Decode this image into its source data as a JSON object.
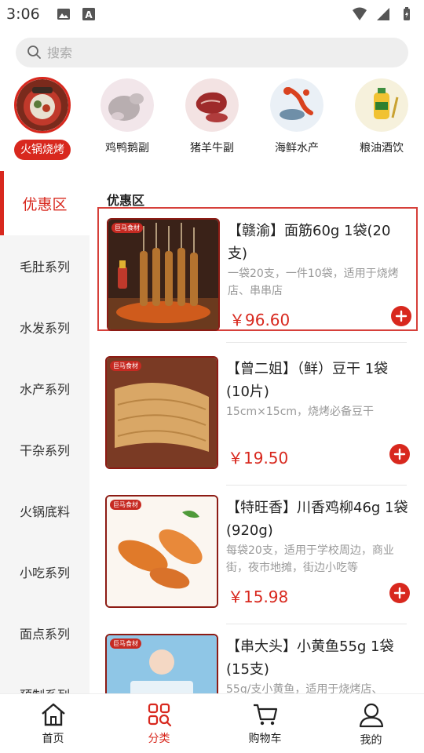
{
  "status_bar": {
    "time": "3:06"
  },
  "search": {
    "placeholder": "搜索"
  },
  "categories": [
    {
      "label": "火锅烧烤",
      "active": true
    },
    {
      "label": "鸡鸭鹅副"
    },
    {
      "label": "猪羊牛副"
    },
    {
      "label": "海鲜水产"
    },
    {
      "label": "粮油酒饮"
    }
  ],
  "sidebar": {
    "items": [
      {
        "label": "优惠区",
        "active": true
      },
      {
        "label": "毛肚系列"
      },
      {
        "label": "水发系列"
      },
      {
        "label": "水产系列"
      },
      {
        "label": "干杂系列"
      },
      {
        "label": "火锅底料"
      },
      {
        "label": "小吃系列"
      },
      {
        "label": "面点系列"
      },
      {
        "label": "预制系列"
      }
    ]
  },
  "section": {
    "title": "优惠区"
  },
  "products": [
    {
      "badge": "巨马食材",
      "name": "【赣渝】面筋60g 1袋(20支)",
      "desc": "一袋20支，一件10袋，适用于烧烤店、串串店",
      "price": "￥96.60"
    },
    {
      "badge": "巨马食材",
      "name": "【曾二姐】（鲜）豆干 1袋(10片)",
      "desc": "15cm×15cm，烧烤必备豆干",
      "price": "￥19.50"
    },
    {
      "badge": "巨马食材",
      "name": "【特旺香】川香鸡柳46g 1袋(920g)",
      "desc": "每袋20支，适用于学校周边，商业街，夜市地摊，街边小吃等",
      "price": "￥15.98"
    },
    {
      "badge": "巨马食材",
      "name": "【串大头】小黄鱼55g 1袋(15支)",
      "desc": "55g/支小黄鱼，适用于烧烤店、",
      "price": ""
    }
  ],
  "tabs": [
    {
      "label": "首页"
    },
    {
      "label": "分类",
      "active": true
    },
    {
      "label": "购物车"
    },
    {
      "label": "我的"
    }
  ],
  "colors": {
    "accent": "#d8281e",
    "sidebar_bg": "#f5f5f5"
  }
}
